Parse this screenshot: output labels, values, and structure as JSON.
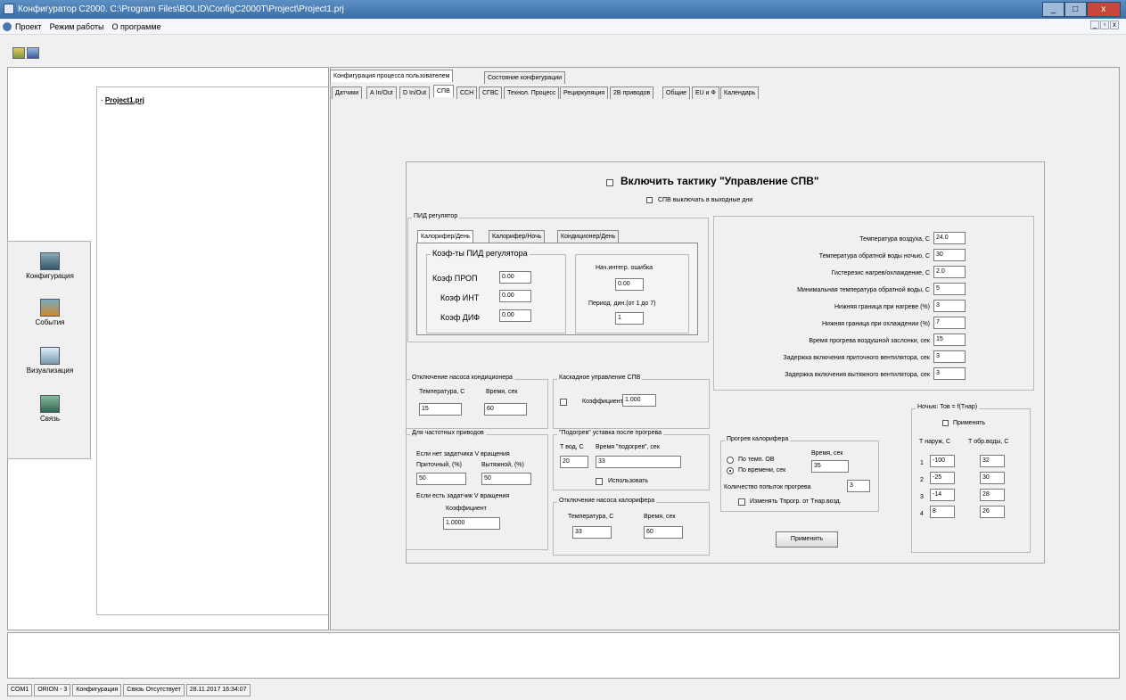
{
  "window": {
    "title": "Конфигуратор C2000. C:\\Program Files\\BOLID\\ConfigC2000T\\Project\\Project1.prj",
    "controls": {
      "minimize": "_",
      "maximize": "□",
      "close": "x"
    }
  },
  "menu": [
    "Проект",
    "Режим работы",
    "О программе"
  ],
  "mdi_controls": {
    "minimize": "_",
    "restore": "▫",
    "close": "x"
  },
  "tree": {
    "root": "Project1.prj"
  },
  "iconbar": [
    "Конфигурация",
    "События",
    "Визуализация",
    "Связь"
  ],
  "tabs_top": [
    "Конфигурация процесса пользователем",
    "Состояние конфигурации"
  ],
  "tabs_second": [
    "Датчики",
    "А In/Out",
    "D In/Out",
    "СПВ",
    "ССН",
    "СГВС",
    "Технол. Процесс",
    "Рециркуляция",
    "2В приводов",
    "Общие",
    "EU и Ф",
    "Календарь"
  ],
  "main": {
    "enable_label": "Включить тактику \"Управление СПВ\"",
    "dayoff_label": "СПВ выключать в выходные дни",
    "pid": {
      "caption": "ПИД регулятор",
      "tabs": [
        "Калорифер/День",
        "Калорифер/Ночь",
        "Кондиционер/День"
      ],
      "coef_caption": "Коэф-ты ПИД регулятора",
      "kp_label": "Коэф ПРОП",
      "kp": "0.00",
      "ki_label": "Коэф ИНТ",
      "ki": "0.00",
      "kd_label": "Коэф ДИФ",
      "kd": "0.00",
      "err_label": "Нач.интегр. ошибка",
      "err": "0.00",
      "period_label": "Период. дин.(от 1 до 7)",
      "period": "1"
    },
    "params": [
      {
        "label": "Температура воздуха, С",
        "value": "24.0"
      },
      {
        "label": "Температура обратной воды ночью, С",
        "value": "30"
      },
      {
        "label": "Гистерезис нагрев/охлаждение, С",
        "value": "2.0"
      },
      {
        "label": "Минимальная температура обратной воды, С",
        "value": "5"
      },
      {
        "label": "Нижняя граница при нагреве (%)",
        "value": "3"
      },
      {
        "label": "Нижняя граница при охлаждении (%)",
        "value": "7"
      },
      {
        "label": "Время прогрева воздушной заслонки, сек",
        "value": "15"
      },
      {
        "label": "Задержка включения приточного вентилятора, сек",
        "value": "3"
      },
      {
        "label": "Задержка включения вытяжного вентилятора, сек",
        "value": "3"
      }
    ],
    "pump_off": {
      "caption": "Отключение насоса кондиционера",
      "temp_label": "Температура, С",
      "time_label": "Время, сек",
      "temp": "15",
      "time": "60"
    },
    "cascade": {
      "caption": "Каскадное управление СПВ",
      "coef_label": "Коэффициент",
      "coef": "1.000"
    },
    "freq": {
      "caption": "Для частотных приводов",
      "no_sensor": "Если нет задатчика V вращения",
      "supply_label": "Приточный, (%)",
      "exhaust_label": "Вытяжной, (%)",
      "supply": "50",
      "exhaust": "50",
      "with_sensor": "Если есть задатчик V вращения",
      "coef_label": "Коэффициент",
      "coef": "1.0000"
    },
    "winter": {
      "caption": "\"Подогрев\" уставка после прогрева",
      "temp_label": "Т вод, С",
      "time_label": "Время \"подогрев\", сек",
      "temp": "20",
      "time": "33",
      "use_label": "Использовать"
    },
    "heater_pump": {
      "caption": "Отключение насоса калорифера",
      "temp_label": "Температура, С",
      "time_label": "Время, сек",
      "temp": "33",
      "time": "60"
    },
    "heater_warm": {
      "caption": "Прогрев калорифера",
      "opt1": "По темп. ОВ",
      "opt2": "По времени, сек",
      "time_label": "Время, сек",
      "time": "35",
      "count_label": "Количество попыток прогрева",
      "count": "3",
      "change_label": "Изменять Тпрогр. от Тнар.возд."
    },
    "apply": "Применить",
    "night": {
      "caption": "Ночью: Тов = f(Тнар)",
      "apply_label": "Применять",
      "col1": "Т наруж, С",
      "col2": "Т обр.воды, С",
      "rows": [
        {
          "n": "1",
          "t": "-100",
          "v": "32"
        },
        {
          "n": "2",
          "t": "-25",
          "v": "30"
        },
        {
          "n": "3",
          "t": "-14",
          "v": "28"
        },
        {
          "n": "4",
          "t": "8",
          "v": "26"
        }
      ]
    }
  },
  "status": [
    "COM1",
    "ORION - 3",
    "Конфигурация",
    "Связь Отсутствует",
    "28.11.2017 16:34:07"
  ]
}
